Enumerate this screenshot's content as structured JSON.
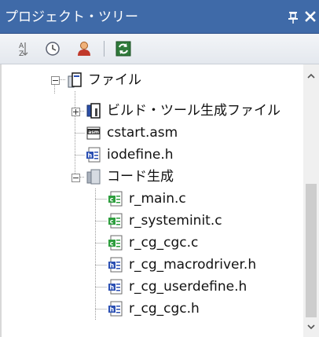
{
  "panel": {
    "title": "プロジェクト・ツリー",
    "pin_glyph": "ㄗ",
    "close_glyph": "✕"
  },
  "toolbar": {
    "buttons": [
      {
        "icon": "sort-icon"
      },
      {
        "icon": "clock-icon"
      },
      {
        "icon": "person-icon"
      },
      {
        "icon": "refresh-icon"
      }
    ]
  },
  "tree": {
    "root": {
      "label": "ファイル",
      "icon": "folder-file-icon",
      "expanded": true
    },
    "children": [
      {
        "label": "ビルド・ツール生成ファイル",
        "icon": "build-tool-folder-icon",
        "expanded": false
      },
      {
        "label": "cstart.asm",
        "icon": "asm-file-icon"
      },
      {
        "label": "iodefine.h",
        "icon": "header-file-icon"
      },
      {
        "label": "コード生成",
        "icon": "folder-icon",
        "expanded": true
      }
    ],
    "codegen_children": [
      {
        "label": "r_main.c",
        "icon": "c-file-icon"
      },
      {
        "label": "r_systeminit.c",
        "icon": "c-file-icon"
      },
      {
        "label": "r_cg_cgc.c",
        "icon": "c-file-icon"
      },
      {
        "label": "r_cg_macrodriver.h",
        "icon": "header-file-icon"
      },
      {
        "label": "r_cg_userdefine.h",
        "icon": "header-file-icon"
      },
      {
        "label": "r_cg_cgc.h",
        "icon": "header-file-icon"
      }
    ]
  },
  "colors": {
    "titlebar": "#3f6aa8",
    "c_file_green": "#2e9e3e",
    "header_blue": "#2a4fb3",
    "folder_gray": "#8a93a0"
  }
}
